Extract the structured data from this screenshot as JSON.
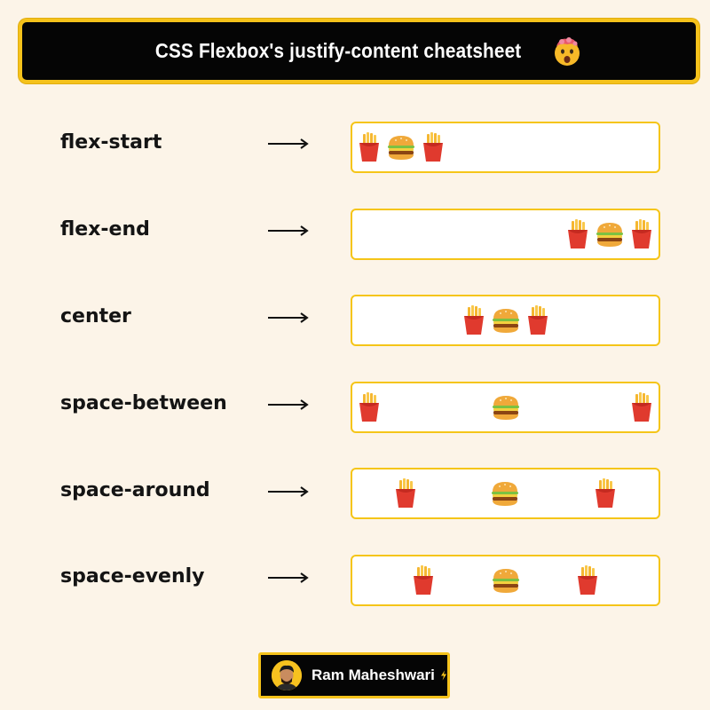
{
  "header": {
    "title": "CSS Flexbox's justify-content cheatsheet",
    "emoji_icon": "mind-blown-emoji-icon"
  },
  "rows": [
    {
      "label": "flex-start",
      "justify": "flex-start",
      "items": [
        "fries",
        "burger",
        "fries"
      ]
    },
    {
      "label": "flex-end",
      "justify": "flex-end",
      "items": [
        "fries",
        "burger",
        "fries"
      ]
    },
    {
      "label": "center",
      "justify": "center",
      "items": [
        "fries",
        "burger",
        "fries"
      ]
    },
    {
      "label": "space-between",
      "justify": "space-between",
      "items": [
        "fries",
        "burger",
        "fries"
      ]
    },
    {
      "label": "space-around",
      "justify": "space-around",
      "items": [
        "fries",
        "burger",
        "fries"
      ]
    },
    {
      "label": "space-evenly",
      "justify": "space-evenly",
      "items": [
        "fries",
        "burger",
        "fries"
      ]
    }
  ],
  "author": {
    "name": "Ram Maheshwari",
    "icon": "lightning-bolt-icon"
  },
  "colors": {
    "background": "#fcf4e8",
    "accent": "#f5c21b",
    "header_bg": "#050505",
    "box_border": "#f5c518"
  }
}
